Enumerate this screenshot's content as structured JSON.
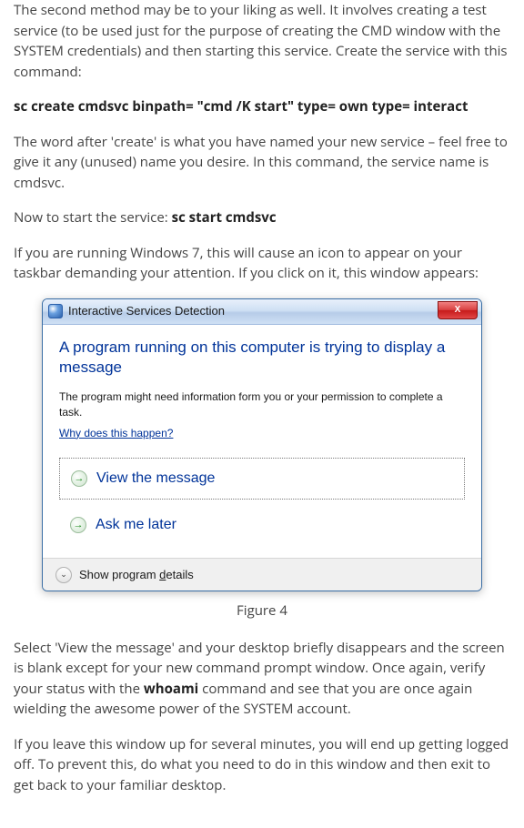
{
  "para1": "The second method may be to your liking as well. It involves creating a test service (to be used just for the purpose of creating the CMD window with the SYSTEM credentials) and then starting this service. Create the service with this command:",
  "cmd1": "sc create cmdsvc binpath= \"cmd /K start\" type= own type= interact",
  "para2": "The word after 'create' is what you have named your new service – feel free to give it any (unused) name you desire. In this command, the service name is cmdsvc.",
  "para3_a": "Now to start the service: ",
  "para3_b": "sc start cmdsvc",
  "para4": "If you are running Windows 7, this will cause an icon to appear on your taskbar demanding your attention. If you click on it, this window appears:",
  "dialog": {
    "title": "Interactive Services Detection",
    "close": "X",
    "heading": "A program running on this computer is trying to display a message",
    "subtext": "The program might need information form you or your permission to complete a task.",
    "why": "Why does this happen?",
    "view": "View the message",
    "ask": "Ask me later",
    "details_a": "Show program ",
    "details_b": "d",
    "details_c": "etails",
    "arrow": "→",
    "chevron": "⌄"
  },
  "figcap": "Figure 4",
  "para5_a": "Select 'View the message' and your desktop briefly disappears and the screen is blank except for your new command prompt window. Once again, verify your status with the ",
  "para5_b": "whoami",
  "para5_c": " command and see that you are once again wielding the awesome power of the SYSTEM account.",
  "para6": "If you leave this window up for several minutes, you will end up getting logged off. To prevent this, do what you need to do in this window and then exit to get back to your familiar desktop."
}
